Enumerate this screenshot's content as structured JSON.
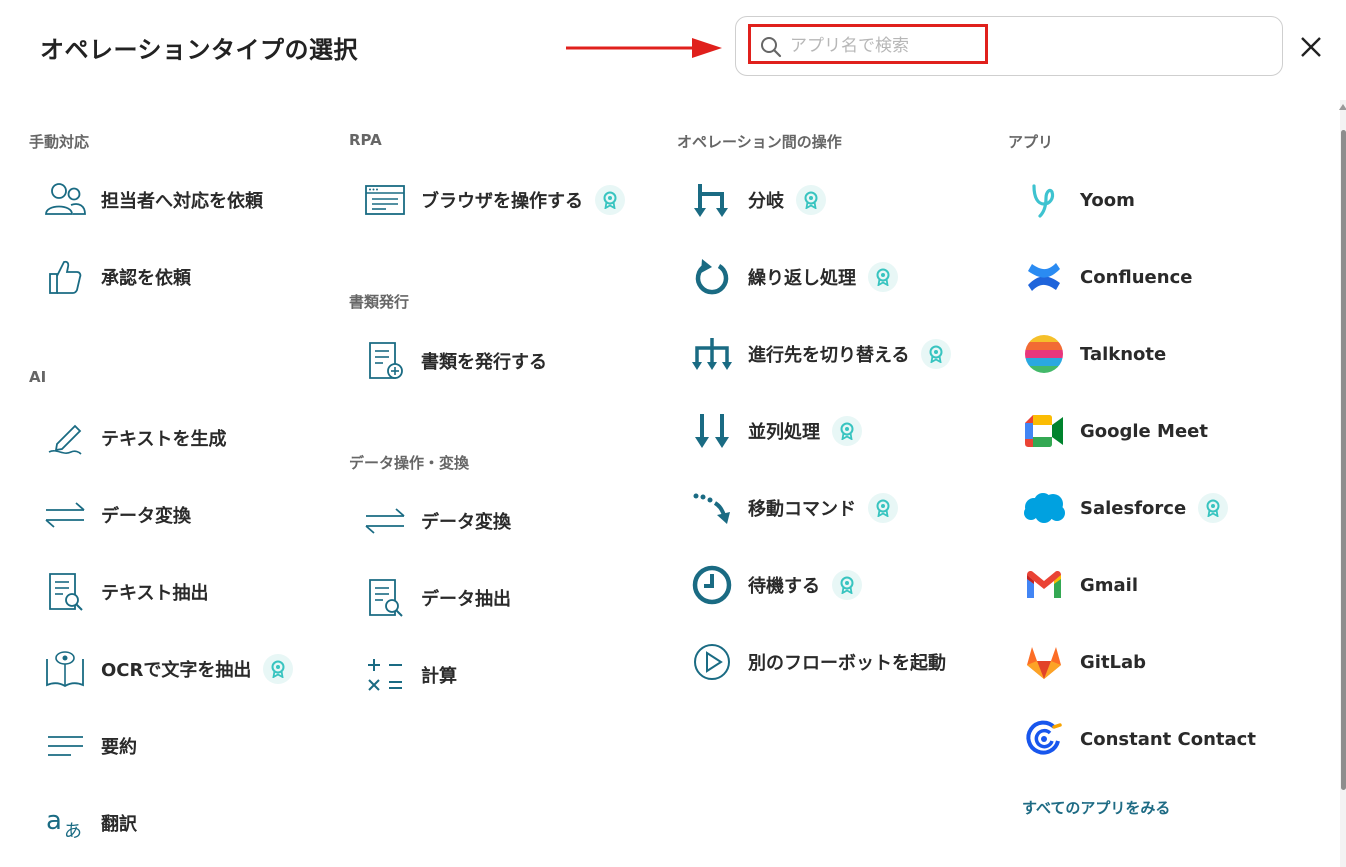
{
  "dialog": {
    "title": "オペレーションタイプの選択",
    "search_placeholder": "アプリ名で検索",
    "search_value": ""
  },
  "colors": {
    "accent": "#1a6b83",
    "badge": "#38c4c0",
    "highlight": "#e0201c"
  },
  "sections": {
    "manual": {
      "title": "手動対応",
      "items": [
        {
          "label": "担当者へ対応を依頼",
          "icon": "people-icon"
        },
        {
          "label": "承認を依頼",
          "icon": "thumbs-up-icon"
        }
      ]
    },
    "ai": {
      "title": "AI",
      "items": [
        {
          "label": "テキストを生成",
          "icon": "pen-icon"
        },
        {
          "label": "データ変換",
          "icon": "swap-arrows-icon"
        },
        {
          "label": "テキスト抽出",
          "icon": "document-search-icon"
        },
        {
          "label": "OCRで文字を抽出",
          "icon": "book-eye-icon",
          "badge": true
        },
        {
          "label": "要約",
          "icon": "lines-icon"
        },
        {
          "label": "翻訳",
          "icon": "translate-icon"
        }
      ]
    },
    "rpa": {
      "title": "RPA",
      "items": [
        {
          "label": "ブラウザを操作する",
          "icon": "browser-icon",
          "badge": true
        }
      ]
    },
    "docs": {
      "title": "書類発行",
      "items": [
        {
          "label": "書類を発行する",
          "icon": "document-add-icon"
        }
      ]
    },
    "data_ops": {
      "title": "データ操作・変換",
      "items": [
        {
          "label": "データ変換",
          "icon": "swap-arrows-icon"
        },
        {
          "label": "データ抽出",
          "icon": "document-search-icon"
        },
        {
          "label": "計算",
          "icon": "calculator-icon"
        }
      ]
    },
    "between_ops": {
      "title": "オペレーション間の操作",
      "items": [
        {
          "label": "分岐",
          "icon": "branch-icon",
          "badge": true
        },
        {
          "label": "繰り返し処理",
          "icon": "loop-icon",
          "badge": true
        },
        {
          "label": "進行先を切り替える",
          "icon": "switch-icon",
          "badge": true
        },
        {
          "label": "並列処理",
          "icon": "parallel-icon",
          "badge": true
        },
        {
          "label": "移動コマンド",
          "icon": "move-icon",
          "badge": true
        },
        {
          "label": "待機する",
          "icon": "clock-icon",
          "badge": true
        },
        {
          "label": "別のフローボットを起動",
          "icon": "play-icon"
        }
      ]
    },
    "apps": {
      "title": "アプリ",
      "items": [
        {
          "label": "Yoom",
          "icon": "yoom-logo-icon"
        },
        {
          "label": "Confluence",
          "icon": "confluence-logo-icon"
        },
        {
          "label": "Talknote",
          "icon": "talknote-logo-icon"
        },
        {
          "label": "Google Meet",
          "icon": "google-meet-logo-icon"
        },
        {
          "label": "Salesforce",
          "icon": "salesforce-logo-icon",
          "badge": true
        },
        {
          "label": "Gmail",
          "icon": "gmail-logo-icon"
        },
        {
          "label": "GitLab",
          "icon": "gitlab-logo-icon"
        },
        {
          "label": "Constant Contact",
          "icon": "constant-contact-logo-icon"
        }
      ],
      "see_all": "すべてのアプリをみる"
    }
  }
}
